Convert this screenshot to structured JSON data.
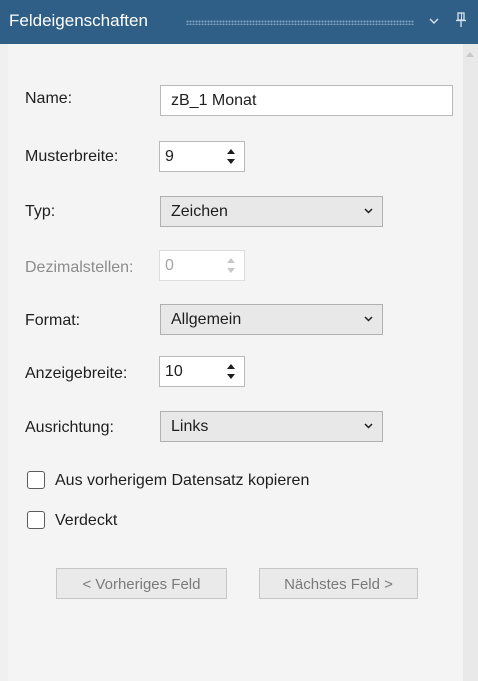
{
  "panel": {
    "title": "Feldeigenschaften",
    "collapse_glyph": "⌄",
    "pin_glyph": "ꟼ"
  },
  "fields": {
    "name": {
      "label": "Name:",
      "value": "zB_1 Monat"
    },
    "musterbreite": {
      "label": "Musterbreite:",
      "value": "9"
    },
    "typ": {
      "label": "Typ:",
      "value": "Zeichen"
    },
    "dezimalstellen": {
      "label": "Dezimalstellen:",
      "value": "0"
    },
    "format": {
      "label": "Format:",
      "value": "Allgemein"
    },
    "anzeigebreite": {
      "label": "Anzeigebreite:",
      "value": "10"
    },
    "ausrichtung": {
      "label": "Ausrichtung:",
      "value": "Links"
    }
  },
  "checkboxes": {
    "kopieren": {
      "label": "Aus vorherigem Datensatz kopieren",
      "checked": false
    },
    "verdeckt": {
      "label": "Verdeckt",
      "checked": false
    }
  },
  "buttons": {
    "previous": "< Vorheriges Feld",
    "next": "Nächstes Feld >"
  },
  "colors": {
    "titlebar": "#2f5e86",
    "panel_bg": "#f4f4f4",
    "disabled_text": "#8c8c8c"
  },
  "icons": {
    "collapse": "chevron-down-icon",
    "pin": "pin-icon",
    "dropdown": "chevron-down-icon",
    "spin": "spinner-arrows-icon"
  }
}
